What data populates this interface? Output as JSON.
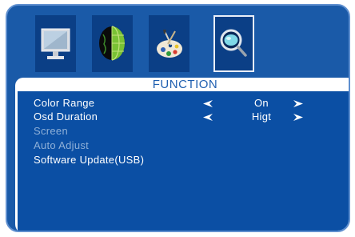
{
  "icons": [
    {
      "name": "picture-monitor-icon",
      "selected": false
    },
    {
      "name": "sound-globe-icon",
      "selected": false
    },
    {
      "name": "setup-palette-icon",
      "selected": false
    },
    {
      "name": "function-magnifier-icon",
      "selected": true
    }
  ],
  "menu": {
    "title": "FUNCTION",
    "items": [
      {
        "label": "Color Range",
        "value": "On",
        "has_arrows": true,
        "enabled": true
      },
      {
        "label": "Osd Duration",
        "value": "Higt",
        "has_arrows": true,
        "enabled": true
      },
      {
        "label": "Screen",
        "value": "",
        "has_arrows": false,
        "enabled": false
      },
      {
        "label": "Auto Adjust",
        "value": "",
        "has_arrows": false,
        "enabled": false
      },
      {
        "label": "Software Update(USB)",
        "value": "",
        "has_arrows": false,
        "enabled": true
      }
    ]
  },
  "colors": {
    "frame": "#1a5aa8",
    "panel": "#0b4fa4",
    "title": "#1f5fb0",
    "enabled_text": "#ffffff",
    "disabled_text": "#8fb0d8"
  }
}
